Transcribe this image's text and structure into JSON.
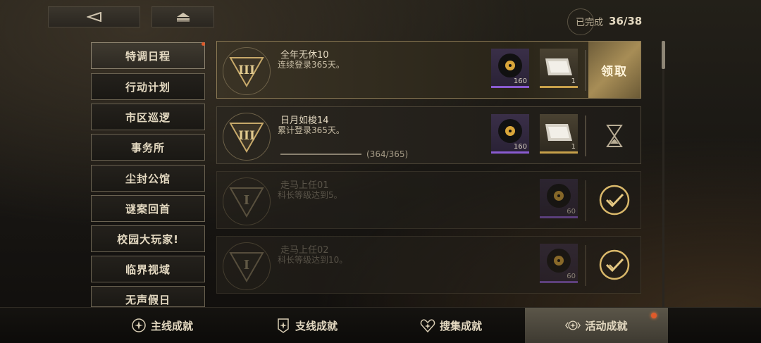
{
  "progress": {
    "label": "已完成",
    "count": "36/38"
  },
  "sidebar": {
    "items": [
      {
        "label": "特调日程"
      },
      {
        "label": "行动计划"
      },
      {
        "label": "市区巡逻"
      },
      {
        "label": "事务所"
      },
      {
        "label": "尘封公馆"
      },
      {
        "label": "谜案回首"
      },
      {
        "label": "校园大玩家!"
      },
      {
        "label": "临界视域"
      },
      {
        "label": "无声假日"
      }
    ]
  },
  "achievements": [
    {
      "title": "全年无休10",
      "desc": "连续登录365天。",
      "reward1_qty": "160",
      "reward2_qty": "1",
      "action": "领取"
    },
    {
      "title": "日月如梭14",
      "desc": "累计登录365天。",
      "reward1_qty": "160",
      "reward2_qty": "1",
      "progress_text": "(364/365)"
    },
    {
      "title": "走马上任01",
      "desc": "科长等级达到5。",
      "reward1_qty": "60"
    },
    {
      "title": "走马上任02",
      "desc": "科长等级达到10。",
      "reward1_qty": "60"
    }
  ],
  "tabs": [
    {
      "label": "主线成就"
    },
    {
      "label": "支线成就"
    },
    {
      "label": "搜集成就"
    },
    {
      "label": "活动成就"
    }
  ],
  "colors": {
    "accent": "#c7a04a",
    "purple_rarity": "#8a5bd0",
    "notify": "#e05a2a"
  }
}
